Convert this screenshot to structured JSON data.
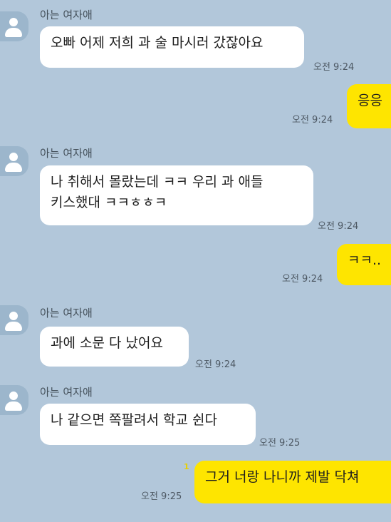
{
  "messages": [
    {
      "side": "in",
      "sender": "아는 여자애",
      "lines": [
        "오빠 어제 저희 과 술 마시러 갔잖아요"
      ],
      "time": "오전 9:24"
    },
    {
      "side": "out",
      "lines": [
        "응응"
      ],
      "time": "오전 9:24"
    },
    {
      "side": "in",
      "sender": "아는 여자애",
      "lines": [
        "나 취해서 몰랐는데 ㅋㅋ 우리 과 애들",
        "키스했대 ㅋㅋㅎㅎㅋ"
      ],
      "time": "오전 9:24"
    },
    {
      "side": "out",
      "lines": [
        "ㅋㅋ.."
      ],
      "time": "오전 9:24"
    },
    {
      "side": "in",
      "sender": "아는 여자애",
      "lines": [
        "과에 소문 다 났어요"
      ],
      "time": "오전 9:24"
    },
    {
      "side": "in",
      "sender": "아는 여자애",
      "lines": [
        "나 같으면 쪽팔려서 학교 쉰다"
      ],
      "time": "오전 9:25"
    },
    {
      "side": "out",
      "lines": [
        "그거 너랑 나니까 제발 닥쳐"
      ],
      "time": "오전 9:25",
      "unread": "1"
    }
  ]
}
